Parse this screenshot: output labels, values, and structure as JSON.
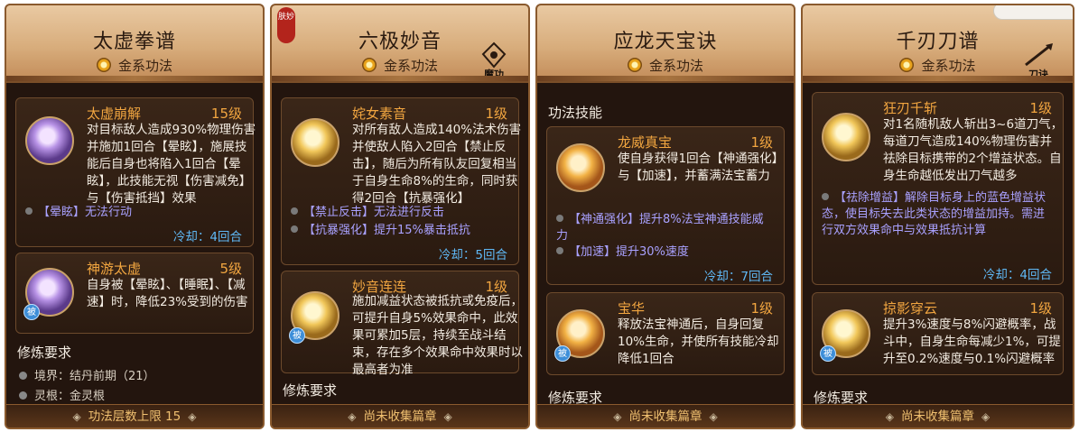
{
  "panels": [
    {
      "title": "太虚拳谱",
      "subtitle": "金系功法",
      "skills": [
        {
          "name": "太虚崩解",
          "level": "15级",
          "desc": "对目标敌人造成930%物理伤害并施加1回合【晕眩】，施展技能后自身也将陷入1回合【晕眩】，此技能无视【伤害减免】与【伤害抵挡】效果",
          "effects": [
            "【晕眩】无法行动"
          ],
          "cooldown": "冷却：4回合"
        },
        {
          "name": "神游太虚",
          "level": "5级",
          "desc": "自身被【晕眩】、【睡眠】、【减速】时，降低23%受到的伤害",
          "badge": "被"
        }
      ],
      "req_title": "修炼要求",
      "reqs": [
        "境界：结丹前期（21）",
        "灵根：金灵根"
      ],
      "footer": "功法层数上限 15"
    },
    {
      "title": "六极妙音",
      "subtitle": "金系功法",
      "corner_label": "魔功",
      "seal": "肤妙",
      "skills": [
        {
          "name": "姹女素音",
          "level": "1级",
          "desc": "对所有敌人造成140%法术伤害并使敌人陷入2回合【禁止反击】，随后为所有队友回复相当于自身生命8%的生命，同时获得2回合【抗暴强化】",
          "effects": [
            "【禁止反击】无法进行反击",
            "【抗暴强化】提升15%暴击抵抗"
          ],
          "cooldown": "冷却：5回合"
        },
        {
          "name": "妙音连连",
          "level": "1级",
          "desc": "施加减益状态被抵抗或免疫后，可提升自身5%效果命中，此效果可累加5层，持续至战斗结束，存在多个效果命中效果时以最高者为准",
          "badge": "被"
        }
      ],
      "req_title": "修炼要求",
      "footer": "尚未收集篇章"
    },
    {
      "title": "应龙天宝诀",
      "subtitle": "金系功法",
      "section": "功法技能",
      "skills": [
        {
          "name": "龙威真宝",
          "level": "1级",
          "desc": "使自身获得1回合【神通强化】与【加速】，并蓄满法宝蓄力",
          "effects": [
            "【神通强化】提升8%法宝神通技能威力",
            "【加速】提升30%速度"
          ],
          "cooldown": "冷却：7回合"
        },
        {
          "name": "宝华",
          "level": "1级",
          "desc": "释放法宝神通后，自身回复10%生命，并使所有技能冷却降低1回合",
          "badge": "被"
        }
      ],
      "req_title": "修炼要求",
      "footer": "尚未收集篇章"
    },
    {
      "title": "千刃刀谱",
      "subtitle": "金系功法",
      "corner_label": "刀诀",
      "skills": [
        {
          "name": "狂刃千斩",
          "level": "1级",
          "desc": "对1名随机敌人斩出3~6道刀气，每道刀气造成140%物理伤害并祛除目标携带的2个增益状态。自身生命越低发出刀气越多",
          "effects": [
            "【祛除增益】解除目标身上的蓝色增益状态，使目标失去此类状态的增益加持。需进行双方效果命中与效果抵抗计算"
          ],
          "cooldown": "冷却：4回合"
        },
        {
          "name": "掠影穿云",
          "level": "1级",
          "desc": "提升3%速度与8%闪避概率，战斗中，自身生命每减少1%，可提升至0.2%速度与0.1%闪避概率",
          "badge": "被"
        }
      ],
      "req_title": "修炼要求",
      "footer": "尚未收集篇章"
    }
  ]
}
